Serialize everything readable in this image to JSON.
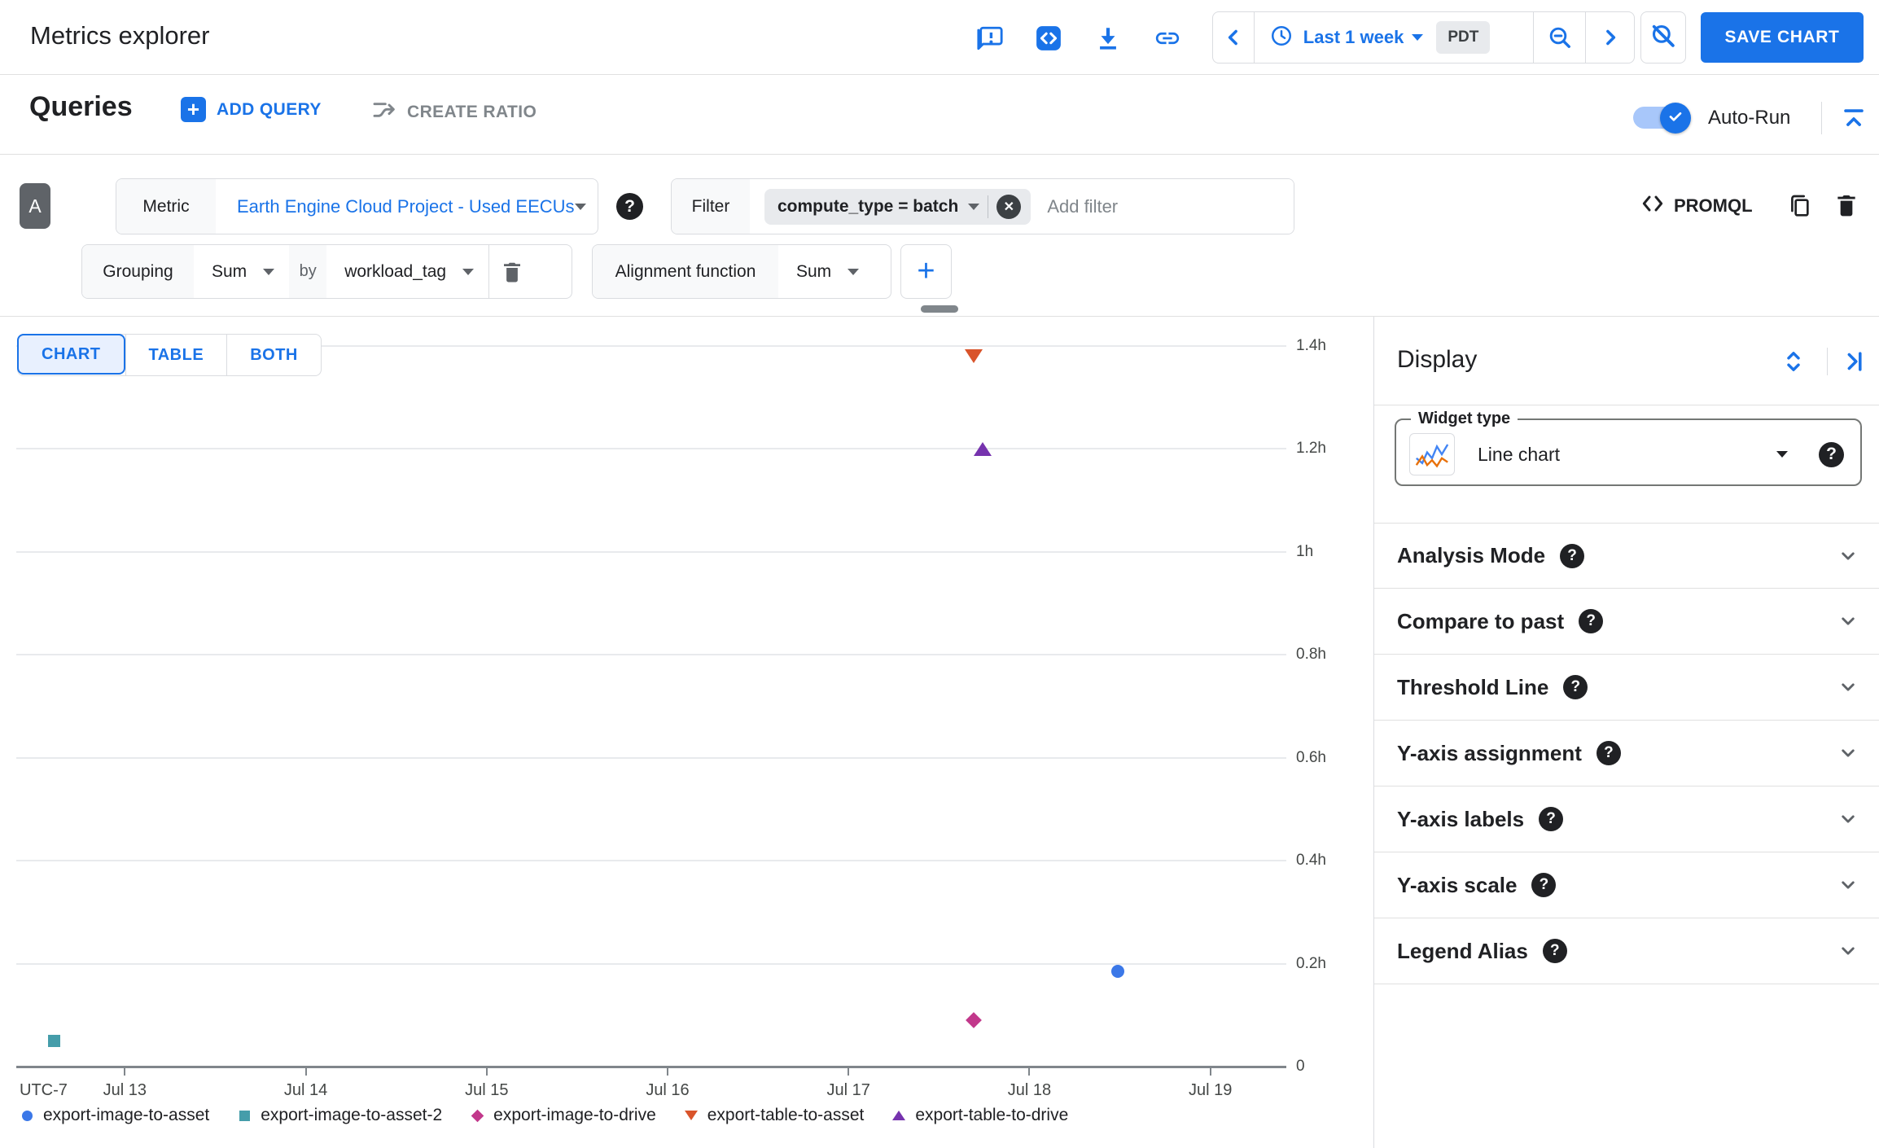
{
  "header": {
    "title": "Metrics explorer",
    "time_range_label": "Last 1 week",
    "timezone": "PDT",
    "save_button": "SAVE CHART"
  },
  "queries_bar": {
    "title": "Queries",
    "add_query": "ADD QUERY",
    "create_ratio": "CREATE RATIO",
    "auto_run_label": "Auto-Run",
    "auto_run_on": true
  },
  "query": {
    "letter": "A",
    "metric_label": "Metric",
    "metric_value": "Earth Engine Cloud Project - Used EECUs",
    "filter_label": "Filter",
    "filter_chip": "compute_type = batch",
    "add_filter_placeholder": "Add filter",
    "promql_label": "PROMQL",
    "grouping_label": "Grouping",
    "grouping_value": "Sum",
    "by_label": "by",
    "by_field": "workload_tag",
    "alignment_label": "Alignment function",
    "alignment_value": "Sum"
  },
  "view_tabs": [
    {
      "label": "CHART",
      "active": true
    },
    {
      "label": "TABLE",
      "active": false
    },
    {
      "label": "BOTH",
      "active": false
    }
  ],
  "display_panel": {
    "title": "Display",
    "widget_type_label": "Widget type",
    "widget_type_value": "Line chart",
    "sections": [
      "Analysis Mode",
      "Compare to past",
      "Threshold Line",
      "Y-axis assignment",
      "Y-axis labels",
      "Y-axis scale",
      "Legend Alias"
    ]
  },
  "icons": {
    "help": "?",
    "close": "✕",
    "plus": "+"
  },
  "colors": {
    "accent": "#1a73e8",
    "text": "#202124",
    "secondary_text": "#5f6368",
    "border": "#dadce0",
    "chip_bg": "#e8eaed",
    "gridline": "#e8eaed",
    "axis": "#80868b"
  },
  "chart_data": {
    "type": "scatter",
    "title": "",
    "x_axis": {
      "timezone_label": "UTC-7",
      "tick_labels": [
        "Jul 13",
        "Jul 14",
        "Jul 15",
        "Jul 16",
        "Jul 17",
        "Jul 18",
        "Jul 19"
      ],
      "tick_values_day_of_july": [
        13,
        14,
        15,
        16,
        17,
        18,
        19
      ],
      "range_day_of_july": [
        12.4,
        19.42
      ]
    },
    "y_axis": {
      "unit": "hours",
      "tick_labels": [
        "1.4h",
        "1.2h",
        "1h",
        "0.8h",
        "0.6h",
        "0.4h",
        "0.2h",
        "0"
      ],
      "tick_values_hours": [
        1.4,
        1.2,
        1.0,
        0.8,
        0.6,
        0.4,
        0.2,
        0
      ],
      "range_hours": [
        0,
        1.4
      ],
      "grid": true
    },
    "legend_position": "bottom",
    "series": [
      {
        "name": "export-image-to-asset",
        "marker": "circle",
        "color": "#3b78e8",
        "points": [
          {
            "day_of_july": 18.49,
            "hours": 0.185
          }
        ]
      },
      {
        "name": "export-image-to-asset-2",
        "marker": "square",
        "color": "#459daa",
        "points": [
          {
            "day_of_july": 12.61,
            "hours": 0.05
          }
        ]
      },
      {
        "name": "export-image-to-drive",
        "marker": "diamond",
        "color": "#c2388b",
        "points": [
          {
            "day_of_july": 17.69,
            "hours": 0.09
          }
        ]
      },
      {
        "name": "export-table-to-asset",
        "marker": "triangle-down",
        "color": "#d9542b",
        "points": [
          {
            "day_of_july": 17.69,
            "hours": 1.38
          }
        ]
      },
      {
        "name": "export-table-to-drive",
        "marker": "triangle-up",
        "color": "#7633ae",
        "points": [
          {
            "day_of_july": 17.74,
            "hours": 1.2
          }
        ]
      }
    ]
  }
}
